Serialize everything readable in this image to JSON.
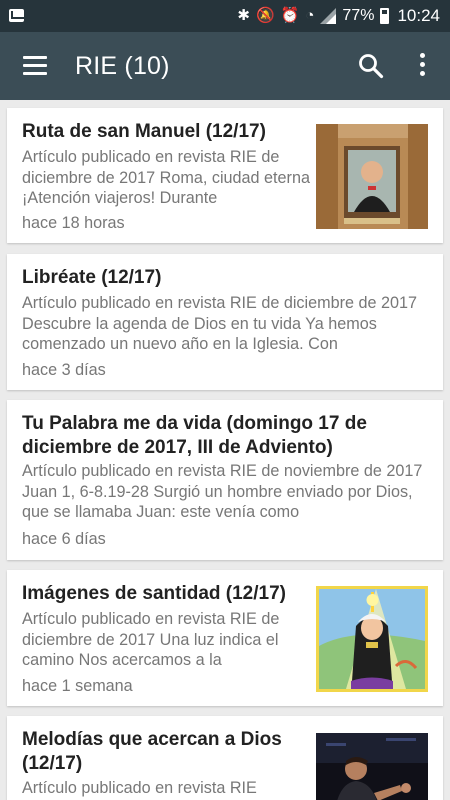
{
  "status_bar": {
    "battery": "77%",
    "time": "10:24"
  },
  "app_bar": {
    "title": "RIE (10)"
  },
  "articles": [
    {
      "title": "Ruta de san Manuel (12/17)",
      "excerpt": "Artículo publicado en revista RIE de diciembre de 2017 Roma, ciudad eterna ¡Atención viajeros! Durante",
      "time": "hace 18 horas",
      "thumbnail": "portrait-banner"
    },
    {
      "title": "Libréate (12/17)",
      "excerpt": "Artículo publicado en revista RIE de diciembre de 2017 Descubre la agenda de Dios en tu vida Ya hemos comenzado un nuevo año en la Iglesia. Con",
      "time": "hace 3 días"
    },
    {
      "title": "Tu Palabra me da vida (domingo 17 de diciembre de 2017, III de Adviento)",
      "excerpt": "Artículo publicado en revista RIE de noviembre de 2017 Juan 1, 6-8.19-28 Surgió un hombre enviado por Dios, que se llamaba Juan: este venía como",
      "time": "hace 6 días"
    },
    {
      "title": "Imágenes de santidad (12/17)",
      "excerpt": "Artículo publicado en revista RIE de diciembre de 2017 Una luz indica el camino Nos acercamos a la",
      "time": "hace 1 semana",
      "thumbnail": "cartoon-illustration"
    },
    {
      "title": "Melodías que acercan a Dios (12/17)",
      "excerpt": "Artículo publicado en revista RIE",
      "thumbnail": "stage-photo"
    }
  ]
}
